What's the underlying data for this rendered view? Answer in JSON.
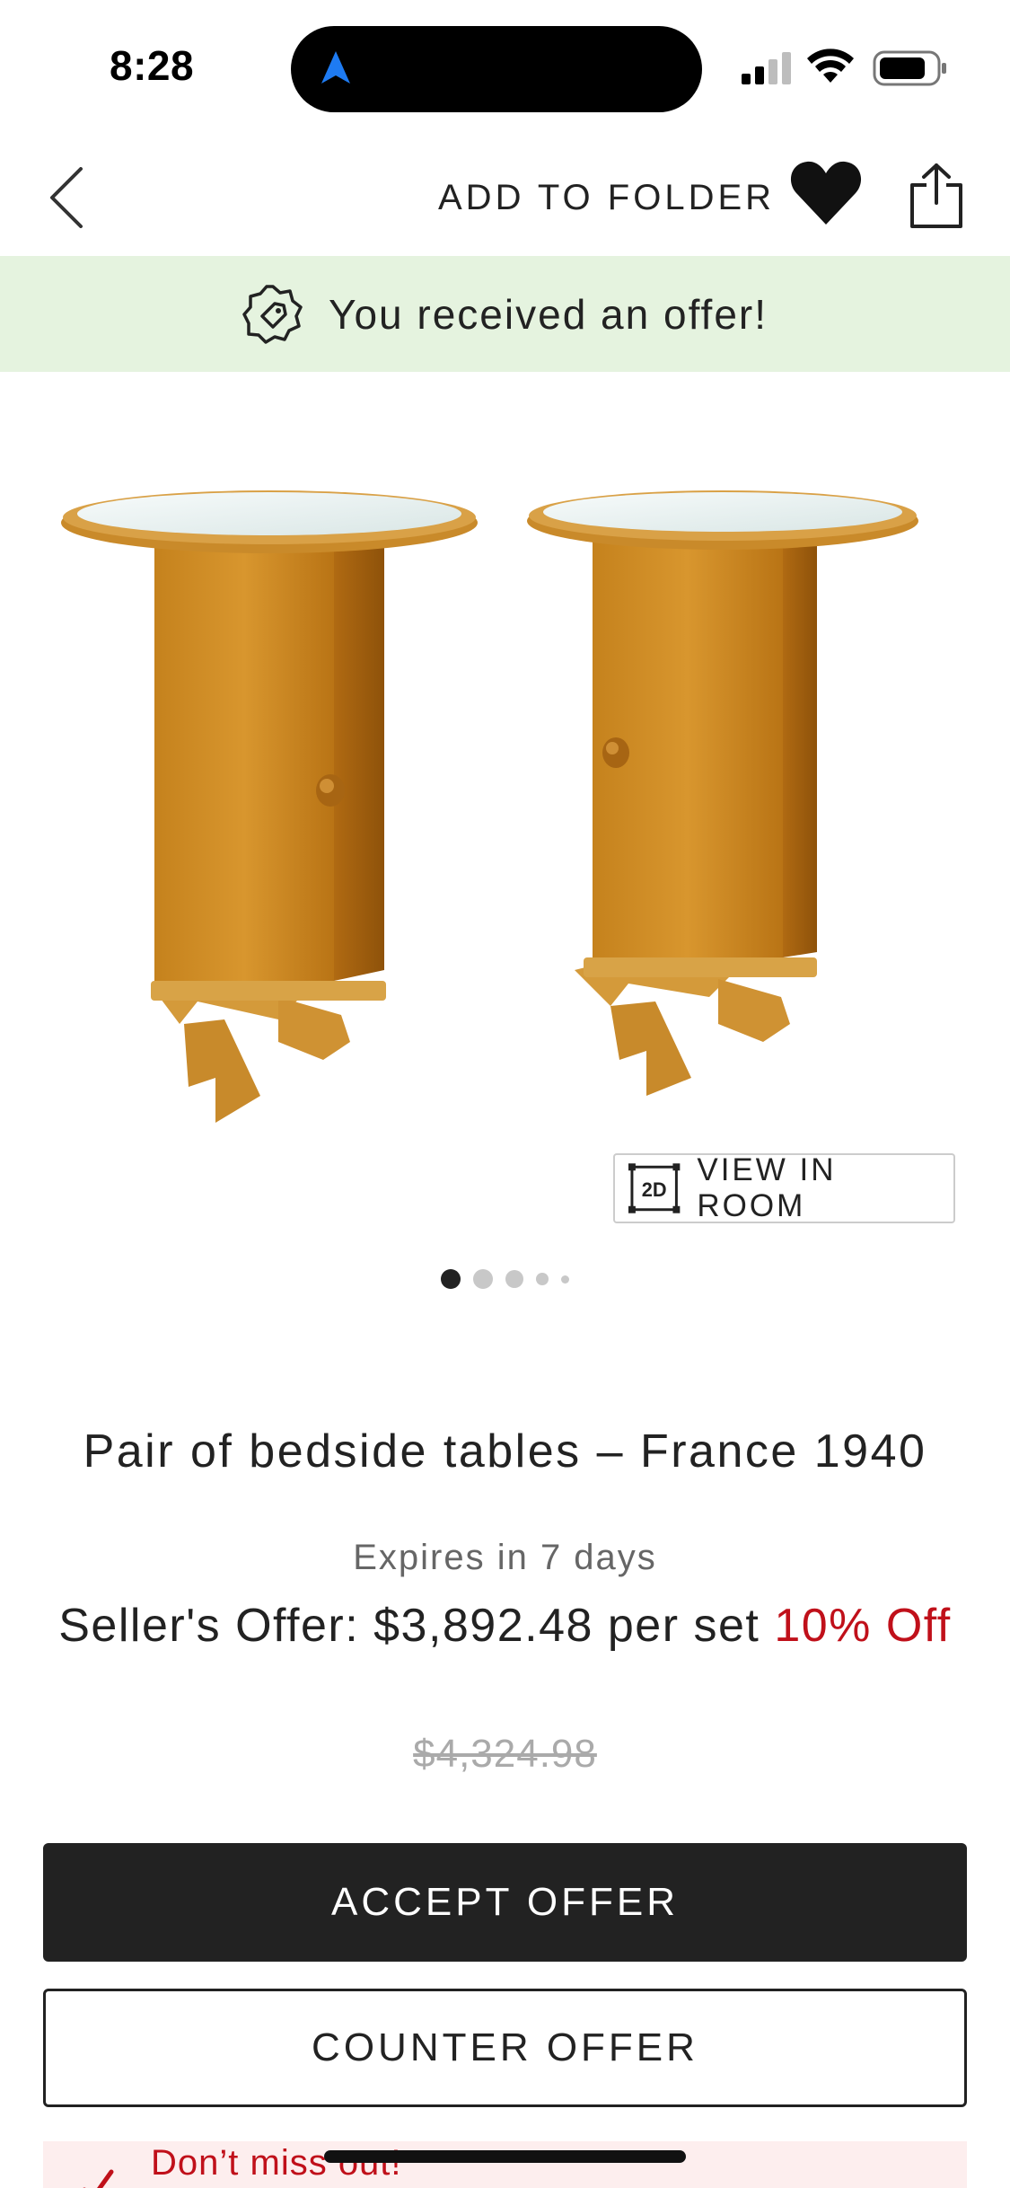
{
  "status_bar": {
    "time": "8:28"
  },
  "nav": {
    "add_to_folder": "ADD TO FOLDER"
  },
  "offer_banner": {
    "text": "You received an offer!",
    "color": "#e5f3df"
  },
  "product": {
    "image_icon": "bedside-tables-photo",
    "view_in_room_badge": "2D",
    "view_in_room_label": "VIEW IN ROOM",
    "carousel": {
      "total": 5,
      "active": 1
    },
    "title": "Pair of bedside tables – France 1940",
    "expires": "Expires in 7 days",
    "offer_prefix": "Seller's Offer: $3,892.48 per set",
    "discount": "10% Off",
    "original_price": "$4,324.98"
  },
  "actions": {
    "accept": "ACCEPT OFFER",
    "counter": "COUNTER OFFER"
  },
  "notice": {
    "text": "Don’t miss out!",
    "accent": "#c0101a"
  }
}
